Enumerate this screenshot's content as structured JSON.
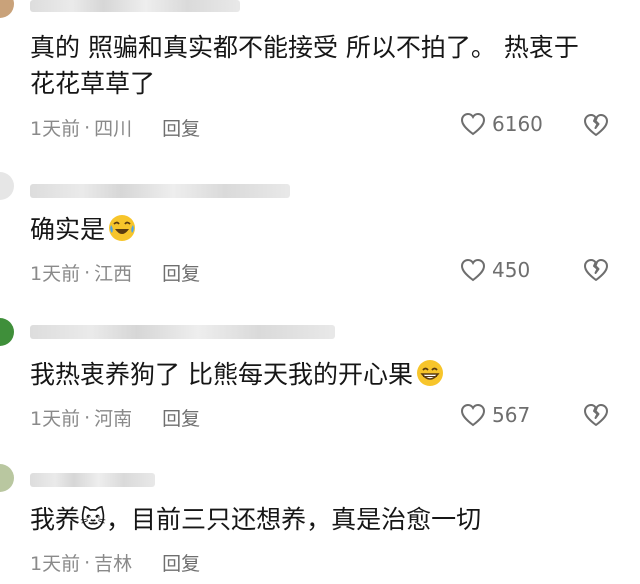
{
  "comments": [
    {
      "content_line1": "真的 照骗和真实都不能接受  所以不拍了。 热衷于",
      "content_line2": "花花草草了",
      "time": "1天前",
      "separator": "·",
      "location": "四川",
      "reply_label": "回复",
      "likes": "6160"
    },
    {
      "content": "确实是",
      "emoji_icon": "laughing-crying-emoji-icon",
      "time": "1天前",
      "separator": "·",
      "location": "江西",
      "reply_label": "回复",
      "likes": "450"
    },
    {
      "content": "我热衷养狗了 比熊每天我的开心果",
      "emoji_icon": "grinning-emoji-icon",
      "time": "1天前",
      "separator": "·",
      "location": "河南",
      "reply_label": "回复",
      "likes": "567"
    },
    {
      "content": "我养🐱，目前三只还想养，真是治愈一切",
      "time": "1天前",
      "separator": "·",
      "location": "吉林",
      "reply_label": "回复"
    }
  ],
  "colors": {
    "text": "#161616",
    "meta": "#8a8a8a",
    "icon": "#6e6e6e",
    "emoji": "#f7c52b"
  }
}
